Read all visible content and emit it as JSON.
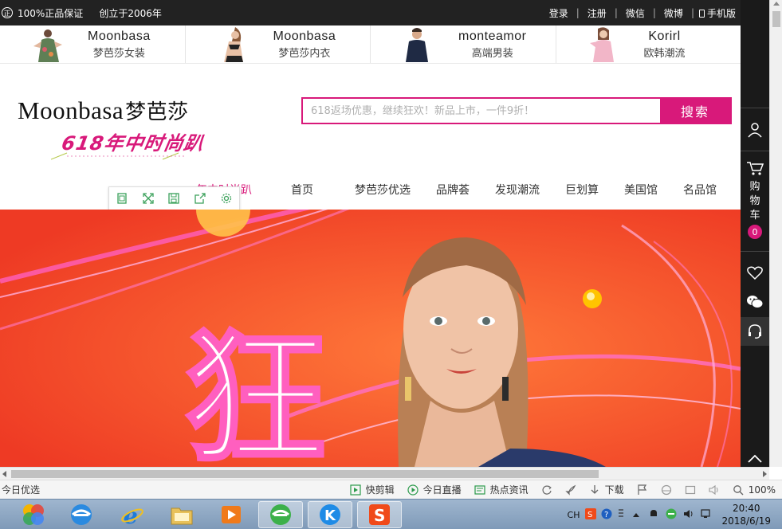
{
  "topbar": {
    "guarantee": "100%正品保证",
    "guarantee_icon_char": "正",
    "founded": "创立于2006年",
    "links": [
      "登录",
      "注册",
      "微信",
      "微博",
      "手机版"
    ],
    "separator": "|"
  },
  "brands": [
    {
      "name": "Moonbasa",
      "sub": "梦芭莎女装"
    },
    {
      "name": "Moonbasa",
      "sub": "梦芭莎内衣"
    },
    {
      "name": "monteamor",
      "sub": "高端男装"
    },
    {
      "name": "Korirl",
      "sub": "欧韩潮流"
    }
  ],
  "header": {
    "logo_en": "Moonbasa",
    "logo_cn": "梦芭莎",
    "slogan": "618年中时尚趴",
    "search_placeholder": "618返场优惠，继续狂欢！新品上市，一件9折！",
    "search_button": "搜索"
  },
  "nav": {
    "items": [
      "年中时尚趴",
      "首页",
      "梦芭莎优选",
      "品牌荟",
      "发现潮流",
      "巨划算",
      "美国馆",
      "名品馆"
    ]
  },
  "banner": {
    "headline_char": "狂",
    "colors": {
      "bg": "#f2482a",
      "accent": "#d8197a"
    }
  },
  "sidebar": {
    "cart_label": [
      "购",
      "物",
      "车"
    ],
    "cart_count": "0",
    "icons": [
      "user-icon",
      "cart-icon",
      "heart-icon",
      "wechat-icon",
      "headset-icon",
      "back-to-top-icon"
    ]
  },
  "statusbar": {
    "left": "今日优选",
    "items": [
      "快剪辑",
      "今日直播",
      "热点资讯",
      "下载"
    ],
    "zoom": "100%"
  },
  "taskbar": {
    "lang": "CH",
    "time": "20:40",
    "date": "2018/6/19"
  }
}
